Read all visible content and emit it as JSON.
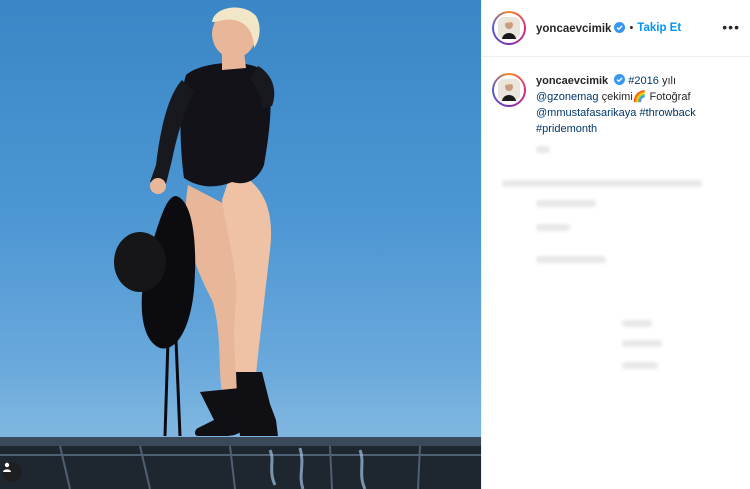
{
  "header": {
    "username": "yoncaevcimik",
    "separator": "•",
    "follow_label": "Takip Et",
    "more_label": "•••"
  },
  "caption": {
    "username": "yoncaevcimik",
    "hashtag_year": "#2016",
    "text_1": "yılı",
    "mention_mag": "@gzonemag",
    "text_2": "çekimi",
    "emoji": "🌈",
    "text_3": "Fotoğraf",
    "mention_photographer": "@mmustafasarikaya",
    "hashtag_throwback": "#throwback",
    "hashtag_pride": "#pridemonth"
  },
  "icons": {
    "verified": "verified-badge-icon",
    "user_tag": "user-tag-icon",
    "more": "more-options-icon"
  },
  "colors": {
    "accent": "#0095f6",
    "link": "#00376b",
    "verified": "#3897f0",
    "sky_top": "#3a86c6",
    "sky_bottom": "#7fb6e0"
  }
}
